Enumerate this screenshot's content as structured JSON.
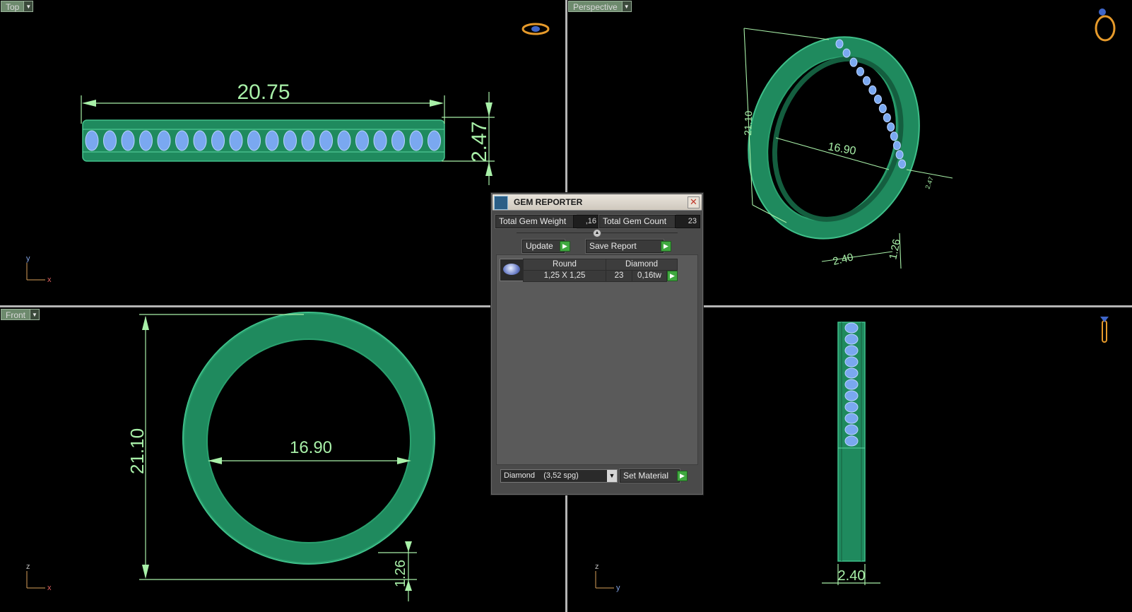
{
  "viewports": {
    "top": {
      "label": "Top",
      "dim_width": "20.75",
      "dim_height": "2.47",
      "axis_v": "y",
      "axis_h": "x"
    },
    "perspective": {
      "label": "Perspective",
      "dim_outer": "21.10",
      "dim_inner": "16.90",
      "dim_width": "2.40",
      "dim_thick": "1.26",
      "dim_top": "2.47"
    },
    "front": {
      "label": "Front",
      "dim_outer": "21.10",
      "dim_inner": "16.90",
      "dim_thick": "1.26",
      "axis_v": "z",
      "axis_h": "x"
    },
    "right": {
      "dim_width": "2.40",
      "axis_v": "z",
      "axis_h": "y"
    }
  },
  "gem_reporter": {
    "title": "GEM REPORTER",
    "total_weight_label": "Total Gem Weight",
    "total_weight_value": ",16",
    "total_count_label": "Total Gem Count",
    "total_count_value": "23",
    "update_label": "Update",
    "save_report_label": "Save Report",
    "table": {
      "headers": [
        "Round",
        "Diamond"
      ],
      "row": {
        "size": "1,25 X 1,25",
        "count": "23",
        "weight": "0,16tw"
      }
    },
    "material_select": "Diamond    (3,52 spg)",
    "set_material_label": "Set Material"
  },
  "colors": {
    "ring_green": "#1f8a5e",
    "gem_blue": "#7aa8f0",
    "dimension": "#a8f0a8",
    "background": "#000000"
  }
}
